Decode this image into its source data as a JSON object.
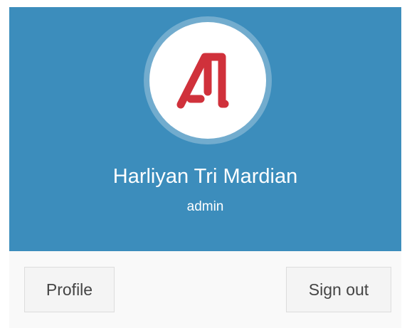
{
  "user": {
    "name": "Harliyan Tri Mardian",
    "role": "admin",
    "logo_icon": "logo-icon"
  },
  "footer": {
    "profile_label": "Profile",
    "signout_label": "Sign out"
  },
  "colors": {
    "header_bg": "#3c8dbc",
    "logo_red": "#d0313b",
    "button_bg": "#f4f4f4",
    "footer_bg": "#f9f9f9"
  }
}
